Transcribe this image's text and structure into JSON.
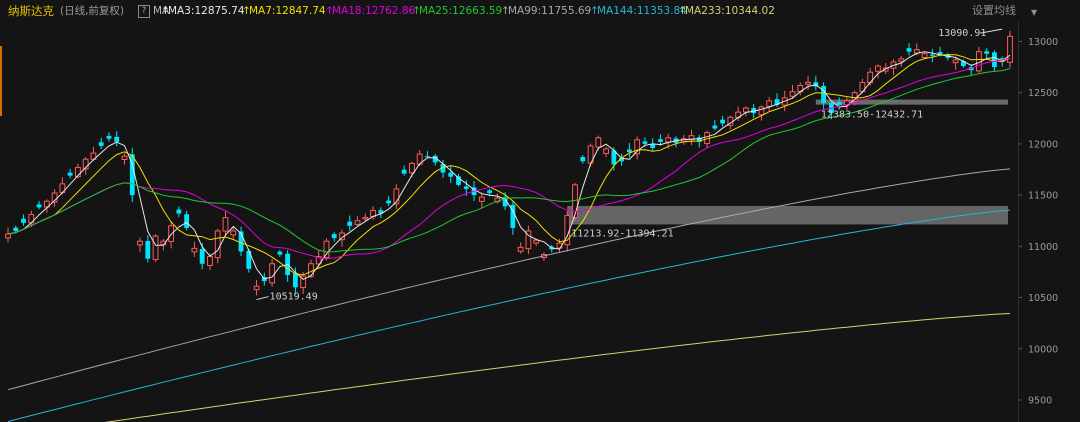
{
  "header": {
    "title": "纳斯达克",
    "subtitle": "(日线,前复权)",
    "q_button": "?",
    "ma_label": "MA",
    "settings_label": "设置均线",
    "settings_icon": "chevron-down-icon"
  },
  "ma_legend": [
    {
      "key": "MA3",
      "text": "MA3:12875.74",
      "color": "#e8e8e8"
    },
    {
      "key": "MA7",
      "text": "MA7:12847.74",
      "color": "#f0e000"
    },
    {
      "key": "MA18",
      "text": "MA18:12762.86",
      "color": "#e000e0"
    },
    {
      "key": "MA25",
      "text": "MA25:12663.59",
      "color": "#22c830"
    },
    {
      "key": "MA99",
      "text": "MA99:11755.69",
      "color": "#a8a8a8"
    },
    {
      "key": "MA144",
      "text": "MA144:11353.84",
      "color": "#20b8d8"
    },
    {
      "key": "MA233",
      "text": "MA233:10344.02",
      "color": "#d8d070"
    }
  ],
  "colors": {
    "up": "#ff5a5a",
    "down": "#00e5ff",
    "background": "#141414",
    "band": "#888888"
  },
  "chart_data": {
    "type": "candlestick",
    "y_axis_ticks": [
      13000,
      12500,
      12000,
      11500,
      11000,
      10500,
      10000,
      9500
    ],
    "ylim": [
      9285,
      13190
    ],
    "n_bars": 130,
    "annotations": {
      "high": {
        "value": 13090.91,
        "text": "13090.91"
      },
      "low": {
        "value": 10519.49,
        "text": "10519.49"
      }
    },
    "gaps": [
      {
        "low": 12383.5,
        "high": 12432.71,
        "text": "12383.50-12432.71"
      },
      {
        "low": 11213.92,
        "high": 11394.21,
        "text": "11213.92-11394.21"
      }
    ],
    "closes": [
      11120,
      11150,
      11230,
      11310,
      11380,
      11440,
      11520,
      11610,
      11690,
      11770,
      11850,
      11910,
      11980,
      12050,
      12020,
      11880,
      11500,
      11050,
      10880,
      11100,
      11050,
      11200,
      11320,
      11180,
      10980,
      10830,
      10900,
      11150,
      11280,
      11150,
      10950,
      10780,
      10610,
      10660,
      10830,
      10920,
      10720,
      10600,
      10710,
      10830,
      10900,
      11050,
      11080,
      11130,
      11200,
      11250,
      11280,
      11350,
      11320,
      11420,
      11560,
      11710,
      11810,
      11900,
      11880,
      11820,
      11720,
      11680,
      11600,
      11560,
      11500,
      11480,
      11520,
      11470,
      11390,
      11180,
      10990,
      11150,
      11060,
      10920,
      10970,
      11030,
      11300,
      11600,
      11830,
      11980,
      12060,
      11950,
      11800,
      11830,
      11920,
      12040,
      12000,
      11960,
      12020,
      12060,
      12010,
      12050,
      12080,
      12020,
      12110,
      12150,
      12200,
      12260,
      12310,
      12350,
      12300,
      12360,
      12420,
      12380,
      12450,
      12510,
      12570,
      12600,
      12560,
      12400,
      12300,
      12380,
      12420,
      12500,
      12600,
      12700,
      12760,
      12740,
      12800,
      12830,
      12900,
      12920,
      12880,
      12860,
      12870,
      12840,
      12820,
      12760,
      12720,
      12900,
      12880,
      12750,
      12800,
      13050
    ],
    "moving_averages": {
      "MA99": {
        "first": 9600,
        "last": 11755.69
      },
      "MA144": {
        "first": 9290,
        "last": 11353.84
      },
      "MA233": {
        "first": 9140,
        "last": 10344.02
      }
    }
  }
}
